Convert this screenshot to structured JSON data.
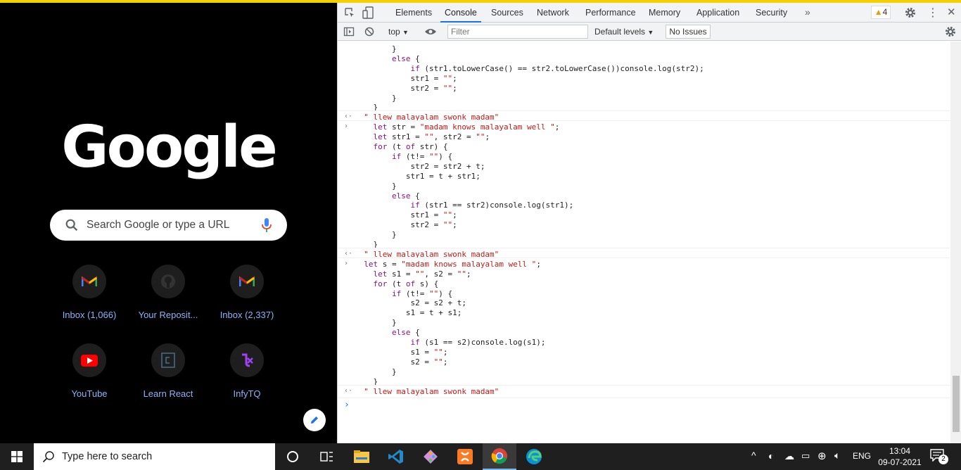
{
  "ntp": {
    "logo": "Google",
    "search_placeholder": "Search Google or type a URL",
    "shortcuts": [
      {
        "label": "Inbox (1,066)",
        "icon": "gmail-icon"
      },
      {
        "label": "Your Reposit...",
        "icon": "github-icon"
      },
      {
        "label": "Inbox (2,337)",
        "icon": "gmail-icon"
      },
      {
        "label": "YouTube",
        "icon": "youtube-icon"
      },
      {
        "label": "Learn React",
        "icon": "learn-react-icon"
      },
      {
        "label": "InfyTQ",
        "icon": "infytq-icon"
      }
    ]
  },
  "devtools": {
    "tabs": [
      "Elements",
      "Console",
      "Sources",
      "Network",
      "Performance",
      "Memory",
      "Application",
      "Security"
    ],
    "active_tab": "Console",
    "warning_count": "4",
    "context": "top",
    "filter_placeholder": "Filter",
    "levels": "Default levels",
    "issues": "No Issues",
    "console_lines": [
      {
        "indent": "        ",
        "parts": [
          {
            "t": "}",
            "c": ""
          }
        ]
      },
      {
        "indent": "        ",
        "parts": [
          {
            "t": "else",
            "c": "kw"
          },
          {
            "t": " {",
            "c": ""
          }
        ]
      },
      {
        "indent": "            ",
        "parts": [
          {
            "t": "if",
            "c": "kw"
          },
          {
            "t": " (str1.toLowerCase() == str2.toLowerCase())console.log(str2);",
            "c": ""
          }
        ]
      },
      {
        "indent": "            ",
        "parts": [
          {
            "t": "str1 = ",
            "c": ""
          },
          {
            "t": "\"\"",
            "c": "str"
          },
          {
            "t": ";",
            "c": ""
          }
        ]
      },
      {
        "indent": "            ",
        "parts": [
          {
            "t": "str2 = ",
            "c": ""
          },
          {
            "t": "\"\"",
            "c": "str"
          },
          {
            "t": ";",
            "c": ""
          }
        ]
      },
      {
        "indent": "        ",
        "parts": [
          {
            "t": "}",
            "c": ""
          }
        ]
      },
      {
        "indent": "    ",
        "parts": [
          {
            "t": "}",
            "c": ""
          }
        ]
      },
      {
        "result": true,
        "indent": "  ",
        "parts": [
          {
            "t": "\" llew malayalam swonk madam\"",
            "c": "res"
          }
        ]
      },
      {
        "input": true,
        "indent": "    ",
        "parts": [
          {
            "t": "let",
            "c": "kw"
          },
          {
            "t": " str = ",
            "c": ""
          },
          {
            "t": "\"madam knows malayalam well \"",
            "c": "str"
          },
          {
            "t": ";",
            "c": ""
          }
        ]
      },
      {
        "indent": "    ",
        "parts": [
          {
            "t": "let",
            "c": "kw"
          },
          {
            "t": " str1 = ",
            "c": ""
          },
          {
            "t": "\"\"",
            "c": "str"
          },
          {
            "t": ", str2 = ",
            "c": ""
          },
          {
            "t": "\"\"",
            "c": "str"
          },
          {
            "t": ";",
            "c": ""
          }
        ]
      },
      {
        "indent": "    ",
        "parts": [
          {
            "t": "for",
            "c": "kw"
          },
          {
            "t": " (t ",
            "c": ""
          },
          {
            "t": "of",
            "c": "kw"
          },
          {
            "t": " str) {",
            "c": ""
          }
        ]
      },
      {
        "indent": "        ",
        "parts": [
          {
            "t": "if",
            "c": "kw"
          },
          {
            "t": " (t!= ",
            "c": ""
          },
          {
            "t": "\"\"",
            "c": "str"
          },
          {
            "t": ") {",
            "c": ""
          }
        ]
      },
      {
        "indent": "            ",
        "parts": [
          {
            "t": "str2 = str2 + t;",
            "c": ""
          }
        ]
      },
      {
        "indent": "           ",
        "parts": [
          {
            "t": "str1 = t + str1;",
            "c": ""
          }
        ]
      },
      {
        "indent": "        ",
        "parts": [
          {
            "t": "}",
            "c": ""
          }
        ]
      },
      {
        "indent": "        ",
        "parts": [
          {
            "t": "else",
            "c": "kw"
          },
          {
            "t": " {",
            "c": ""
          }
        ]
      },
      {
        "indent": "            ",
        "parts": [
          {
            "t": "if",
            "c": "kw"
          },
          {
            "t": " (str1 == str2)console.log(str1);",
            "c": ""
          }
        ]
      },
      {
        "indent": "            ",
        "parts": [
          {
            "t": "str1 = ",
            "c": ""
          },
          {
            "t": "\"\"",
            "c": "str"
          },
          {
            "t": ";",
            "c": ""
          }
        ]
      },
      {
        "indent": "            ",
        "parts": [
          {
            "t": "str2 = ",
            "c": ""
          },
          {
            "t": "\"\"",
            "c": "str"
          },
          {
            "t": ";",
            "c": ""
          }
        ]
      },
      {
        "indent": "        ",
        "parts": [
          {
            "t": "}",
            "c": ""
          }
        ]
      },
      {
        "indent": "    ",
        "parts": [
          {
            "t": "}",
            "c": ""
          }
        ]
      },
      {
        "result": true,
        "indent": "  ",
        "parts": [
          {
            "t": "\" llew malayalam swonk madam\"",
            "c": "res"
          }
        ]
      },
      {
        "input": true,
        "indent": "  ",
        "parts": [
          {
            "t": "let",
            "c": "kw"
          },
          {
            "t": " s = ",
            "c": ""
          },
          {
            "t": "\"madam knows malayalam well \"",
            "c": "str"
          },
          {
            "t": ";",
            "c": ""
          }
        ]
      },
      {
        "indent": "    ",
        "parts": [
          {
            "t": "let",
            "c": "kw"
          },
          {
            "t": " s1 = ",
            "c": ""
          },
          {
            "t": "\"\"",
            "c": "str"
          },
          {
            "t": ", s2 = ",
            "c": ""
          },
          {
            "t": "\"\"",
            "c": "str"
          },
          {
            "t": ";",
            "c": ""
          }
        ]
      },
      {
        "indent": "    ",
        "parts": [
          {
            "t": "for",
            "c": "kw"
          },
          {
            "t": " (t ",
            "c": ""
          },
          {
            "t": "of",
            "c": "kw"
          },
          {
            "t": " s) {",
            "c": ""
          }
        ]
      },
      {
        "indent": "        ",
        "parts": [
          {
            "t": "if",
            "c": "kw"
          },
          {
            "t": " (t!= ",
            "c": ""
          },
          {
            "t": "\"\"",
            "c": "str"
          },
          {
            "t": ") {",
            "c": ""
          }
        ]
      },
      {
        "indent": "            ",
        "parts": [
          {
            "t": "s2 = s2 + t;",
            "c": ""
          }
        ]
      },
      {
        "indent": "           ",
        "parts": [
          {
            "t": "s1 = t + s1;",
            "c": ""
          }
        ]
      },
      {
        "indent": "        ",
        "parts": [
          {
            "t": "}",
            "c": ""
          }
        ]
      },
      {
        "indent": "        ",
        "parts": [
          {
            "t": "else",
            "c": "kw"
          },
          {
            "t": " {",
            "c": ""
          }
        ]
      },
      {
        "indent": "            ",
        "parts": [
          {
            "t": "if",
            "c": "kw"
          },
          {
            "t": " (s1 == s2)console.log(s1);",
            "c": ""
          }
        ]
      },
      {
        "indent": "            ",
        "parts": [
          {
            "t": "s1 = ",
            "c": ""
          },
          {
            "t": "\"\"",
            "c": "str"
          },
          {
            "t": ";",
            "c": ""
          }
        ]
      },
      {
        "indent": "            ",
        "parts": [
          {
            "t": "s2 = ",
            "c": ""
          },
          {
            "t": "\"\"",
            "c": "str"
          },
          {
            "t": ";",
            "c": ""
          }
        ]
      },
      {
        "indent": "        ",
        "parts": [
          {
            "t": "}",
            "c": ""
          }
        ]
      },
      {
        "indent": "    ",
        "parts": [
          {
            "t": "}",
            "c": ""
          }
        ]
      },
      {
        "result": true,
        "indent": "  ",
        "parts": [
          {
            "t": "\" llew malayalam swonk madam\"",
            "c": "res"
          }
        ]
      }
    ]
  },
  "taskbar": {
    "search_placeholder": "Type here to search",
    "lang": "ENG",
    "time": "13:04",
    "date": "09-07-2021",
    "notification_count": "2"
  }
}
